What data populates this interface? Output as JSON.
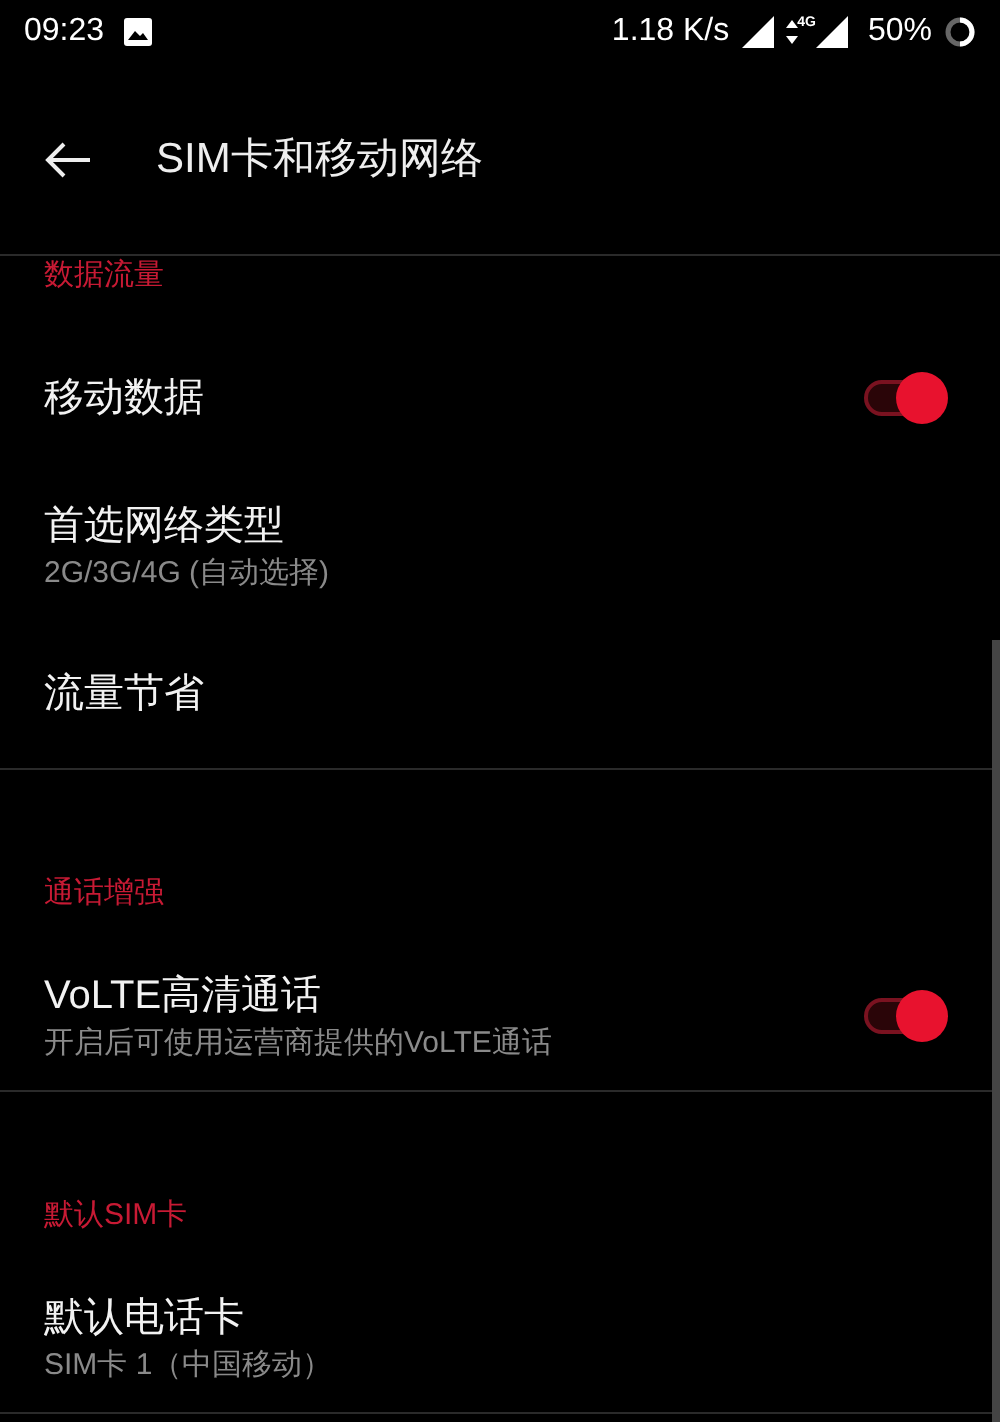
{
  "status_bar": {
    "time": "09:23",
    "speed": "1.18 K/s",
    "network": "4G",
    "battery": "50%"
  },
  "toolbar": {
    "title": "SIM卡和移动网络"
  },
  "sections": [
    {
      "header": "数据流量",
      "items": [
        {
          "kind": "toggle",
          "title": "移动数据",
          "on": true
        },
        {
          "kind": "plain",
          "title": "首选网络类型",
          "summary": "2G/3G/4G (自动选择)"
        },
        {
          "kind": "plain",
          "title": "流量节省"
        }
      ]
    },
    {
      "header": "通话增强",
      "items": [
        {
          "kind": "toggle",
          "title": "VoLTE高清通话",
          "summary": "开启后可使用运营商提供的VoLTE通话",
          "on": true
        }
      ]
    },
    {
      "header": "默认SIM卡",
      "items": [
        {
          "kind": "plain",
          "title": "默认电话卡",
          "summary": "SIM卡 1（中国移动）"
        }
      ]
    }
  ]
}
